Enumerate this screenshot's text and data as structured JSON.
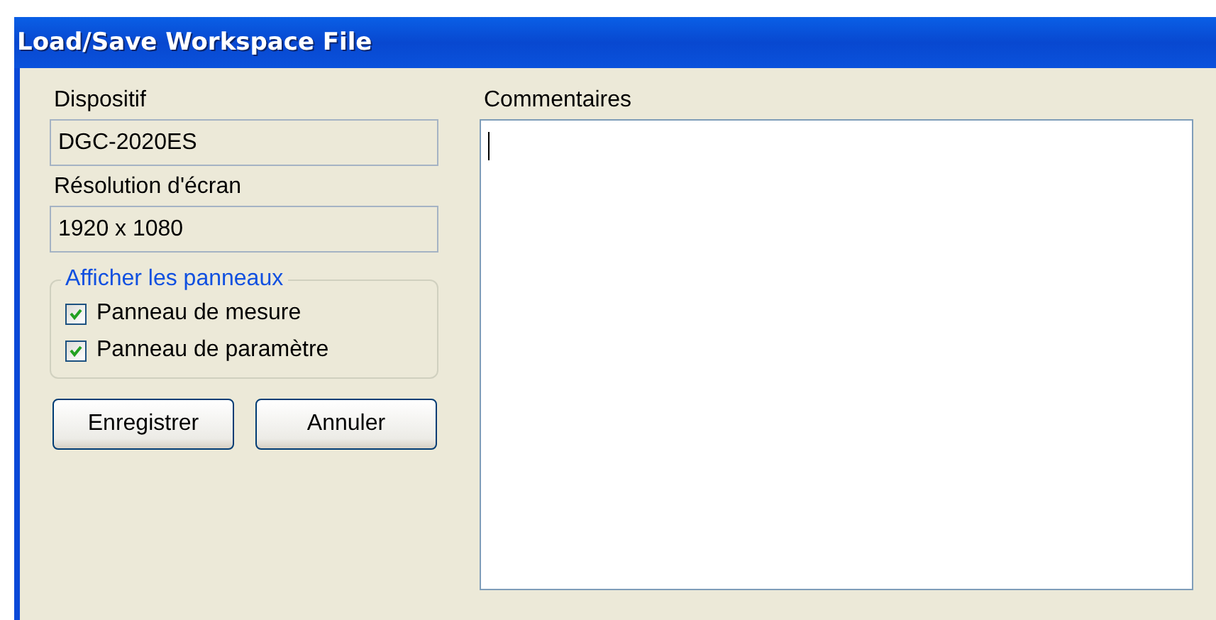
{
  "window": {
    "title": "Load/Save Workspace File"
  },
  "fields": [
    {
      "label": "Dispositif",
      "value": "DGC-2020ES"
    },
    {
      "label": "Résolution d'écran",
      "value": "1920 x 1080"
    }
  ],
  "panels_group": {
    "title": "Afficher les panneaux",
    "options": [
      {
        "label": "Panneau de mesure",
        "checked": true
      },
      {
        "label": "Panneau de paramètre",
        "checked": true
      }
    ]
  },
  "buttons": [
    "Enregistrer",
    "Annuler"
  ],
  "comments": {
    "label": "Commentaires"
  }
}
